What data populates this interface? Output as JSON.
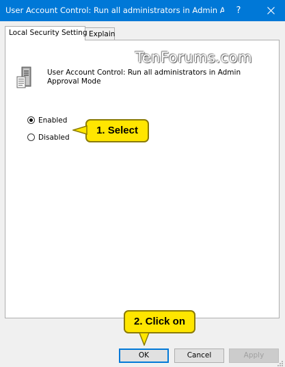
{
  "window": {
    "title": "User Account Control: Run all administrators in Admin Ap...",
    "help_label": "?",
    "close_icon": "close-icon"
  },
  "tabs": [
    {
      "label": "Local Security Setting",
      "active": true
    },
    {
      "label": "Explain",
      "active": false
    }
  ],
  "watermark": "TenForums.com",
  "policy": {
    "icon": "server-icon",
    "title": "User Account Control: Run all administrators in Admin Approval Mode"
  },
  "options": [
    {
      "label": "Enabled",
      "selected": true
    },
    {
      "label": "Disabled",
      "selected": false
    }
  ],
  "callouts": {
    "select": "1. Select",
    "click": "2. Click on"
  },
  "buttons": {
    "ok": "OK",
    "cancel": "Cancel",
    "apply": "Apply"
  },
  "colors": {
    "titlebar": "#0078d7",
    "callout": "#ffe600",
    "focus_border": "#0078d7"
  }
}
